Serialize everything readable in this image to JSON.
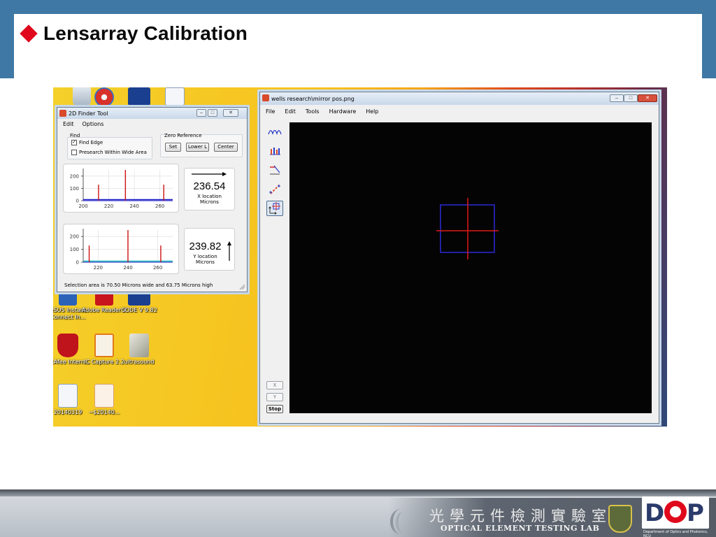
{
  "slide": {
    "title": "Lensarray Calibration",
    "footer_cn": "光學元件檢測實驗室",
    "footer_en": "OPTICAL ELEMENT TESTING LAB",
    "footer_dept": "Department of Optics and Photonics, NCU",
    "logo_text_d": "D",
    "logo_text_p": "P"
  },
  "desktop": {
    "icons": [
      {
        "icon": "recycle-bin-icon",
        "label": ""
      },
      {
        "icon": "app-icon",
        "label": ""
      },
      {
        "icon": "code-v-icon",
        "label": ""
      },
      {
        "icon": "word-doc-icon",
        "label": ""
      },
      {
        "icon": "asus-icon",
        "label": "ASUS Instant Connect In..."
      },
      {
        "icon": "adobe-reader-icon",
        "label": "Adobe Reader X"
      },
      {
        "icon": "code-v-icon",
        "label": "CODE V 9.82"
      },
      {
        "icon": "mcafee-icon",
        "label": "McAfee Intern..."
      },
      {
        "icon": "ic-capture-icon",
        "label": "IC Capture 2.2"
      },
      {
        "icon": "ultrasound-icon",
        "label": "ultrasound"
      },
      {
        "icon": "word-doc-icon",
        "label": "20140319"
      },
      {
        "icon": "ppt-doc-icon",
        "label": "~$20140..."
      }
    ]
  },
  "finder": {
    "title": "2D Finder Tool",
    "menu": [
      "Edit",
      "Options"
    ],
    "find_group": "Find",
    "find_edge_label": "Find Edge",
    "find_edge_checked": true,
    "presearch_label": "Presearch Within Wide Area",
    "presearch_checked": false,
    "zero_ref_group": "Zero Reference",
    "buttons": {
      "set": "Set",
      "lower_l": "Lower L",
      "center": "Center"
    },
    "x_value": "236.54",
    "x_caption": "X location",
    "y_value": "239.82",
    "y_caption": "Y location",
    "units": "Microns",
    "status": "Selection area is 70.50 Microns wide and 63.75 Microns high"
  },
  "chart_data": [
    {
      "type": "bar",
      "xlim": [
        200,
        270
      ],
      "ylim": [
        0,
        250
      ],
      "x_ticks": [
        "200",
        "220",
        "240",
        "260"
      ],
      "y_ticks": [
        "0",
        "100",
        "200"
      ],
      "x": [
        212,
        233,
        263
      ],
      "values": [
        130,
        250,
        130
      ],
      "colors": {
        "bar": "#cc1111",
        "baseline": "#1a1ac8",
        "axis": "#1a1ac8"
      }
    },
    {
      "type": "bar",
      "xlim": [
        210,
        270
      ],
      "ylim": [
        0,
        250
      ],
      "x_ticks": [
        "220",
        "240",
        "260"
      ],
      "y_ticks": [
        "0",
        "100",
        "200"
      ],
      "x": [
        214,
        240,
        262
      ],
      "values": [
        130,
        250,
        130
      ],
      "colors": {
        "bar": "#cc1111",
        "baseline": "#18b8b8",
        "axis": "#1a1ac8"
      }
    }
  ],
  "wells": {
    "title": "wells research\\mirror pos.png",
    "menu": [
      "File",
      "Edit",
      "Tools",
      "Hardware",
      "Help"
    ],
    "tools": [
      "profile-icon",
      "histogram-icon",
      "beam-icon",
      "measure-icon",
      "crosshair-tool-icon"
    ],
    "side_buttons": {
      "x": "X",
      "y": "Y",
      "stop": "Stop"
    },
    "crosshair_color": "#e01818",
    "box_color": "#2a2ad8"
  },
  "colors": {
    "header_band": "#3f78a4",
    "title_diamond": "#e0081c"
  }
}
